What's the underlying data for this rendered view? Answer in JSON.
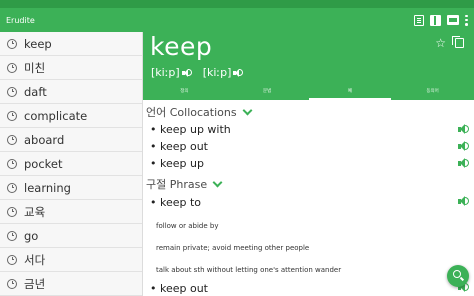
{
  "app": {
    "title": "Erudite"
  },
  "colors": {
    "brand_green": "#3cb157",
    "status_green": "#2f9b47"
  },
  "appbar_icons": [
    "book-outline-icon",
    "book-filled-icon",
    "book-card-icon",
    "more-vert-icon"
  ],
  "history": {
    "items": [
      {
        "label": "keep"
      },
      {
        "label": "미친"
      },
      {
        "label": "daft"
      },
      {
        "label": "complicate"
      },
      {
        "label": "aboard"
      },
      {
        "label": "pocket"
      },
      {
        "label": "learning"
      },
      {
        "label": "교육"
      },
      {
        "label": "go"
      },
      {
        "label": "서다"
      },
      {
        "label": "금년"
      }
    ]
  },
  "entry": {
    "word": "keep",
    "pronunciations": [
      {
        "text": "[kiːp]"
      },
      {
        "text": "[kiːp]"
      }
    ],
    "tabs": [
      {
        "label": "정의",
        "active": false
      },
      {
        "label": "문법",
        "active": false
      },
      {
        "label": "예",
        "active": true
      },
      {
        "label": "동의어",
        "active": false
      }
    ]
  },
  "collocations": {
    "heading": "언어 Collocations",
    "items": [
      {
        "text": "• keep up with"
      },
      {
        "text": "• keep out"
      },
      {
        "text": "• keep up"
      }
    ]
  },
  "phrases": {
    "heading": "구절 Phrase",
    "items": [
      {
        "text": "• keep to",
        "definitions": [
          "follow or abide by",
          "remain private; avoid meeting other people",
          "talk about sth without letting one's attention wander"
        ]
      },
      {
        "text": "• keep out",
        "definitions": []
      }
    ]
  }
}
